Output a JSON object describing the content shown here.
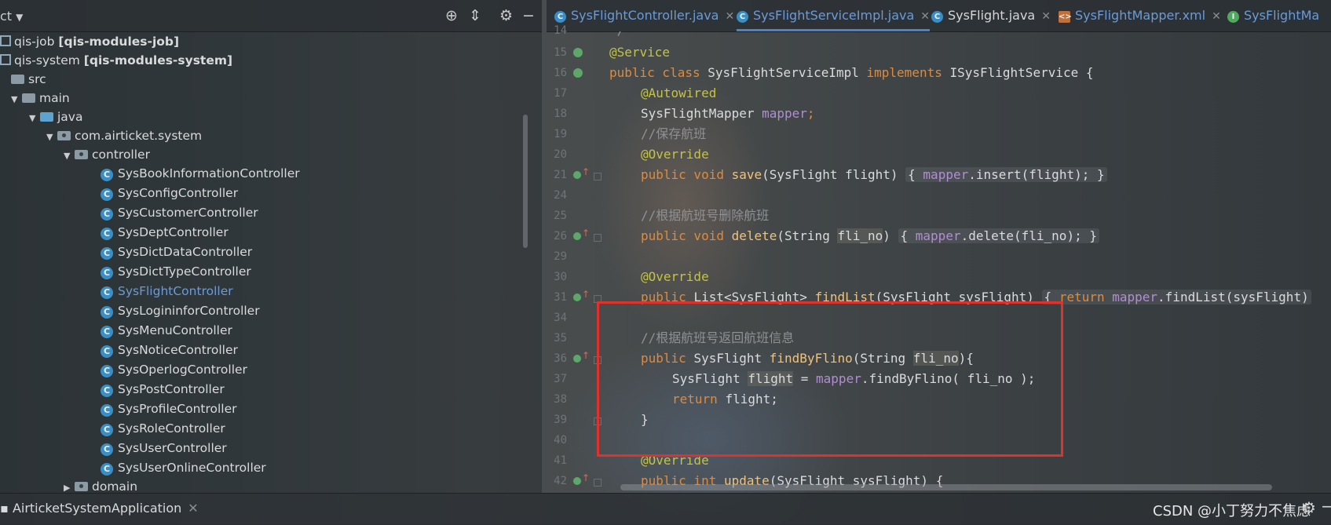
{
  "project_panel": {
    "title": "ct",
    "tree": [
      {
        "label": "qis-job",
        "bold": "[qis-modules-job]",
        "kind": "module"
      },
      {
        "label": "qis-system",
        "bold": "[qis-modules-system]",
        "kind": "module"
      },
      {
        "label": "src",
        "kind": "folder"
      },
      {
        "label": "main",
        "kind": "folder"
      },
      {
        "label": "java",
        "kind": "folder-blue"
      },
      {
        "label": "com.airticket.system",
        "kind": "package"
      },
      {
        "label": "controller",
        "kind": "package"
      },
      {
        "label": "SysBookInformationController",
        "kind": "class"
      },
      {
        "label": "SysConfigController",
        "kind": "class"
      },
      {
        "label": "SysCustomerController",
        "kind": "class"
      },
      {
        "label": "SysDeptController",
        "kind": "class"
      },
      {
        "label": "SysDictDataController",
        "kind": "class"
      },
      {
        "label": "SysDictTypeController",
        "kind": "class"
      },
      {
        "label": "SysFlightController",
        "kind": "class"
      },
      {
        "label": "SysLogininforController",
        "kind": "class"
      },
      {
        "label": "SysMenuController",
        "kind": "class"
      },
      {
        "label": "SysNoticeController",
        "kind": "class"
      },
      {
        "label": "SysOperlogController",
        "kind": "class"
      },
      {
        "label": "SysPostController",
        "kind": "class"
      },
      {
        "label": "SysProfileController",
        "kind": "class"
      },
      {
        "label": "SysRoleController",
        "kind": "class"
      },
      {
        "label": "SysUserController",
        "kind": "class"
      },
      {
        "label": "SysUserOnlineController",
        "kind": "class"
      },
      {
        "label": "domain",
        "kind": "package"
      }
    ]
  },
  "editor": {
    "tabs": [
      {
        "label": "SysFlightController.java",
        "icon": "C"
      },
      {
        "label": "SysFlightServiceImpl.java",
        "icon": "C"
      },
      {
        "label": "SysFlight.java",
        "icon": "C"
      },
      {
        "label": "SysFlightMapper.xml",
        "icon": "xml"
      },
      {
        "label": "SysFlightMa",
        "icon": "I"
      }
    ],
    "line_numbers": [
      "14",
      "15",
      "16",
      "17",
      "18",
      "19",
      "20",
      "21",
      "24",
      "25",
      "26",
      "29",
      "30",
      "31",
      "34",
      "35",
      "36",
      "37",
      "38",
      "39",
      "40",
      "41",
      "42"
    ],
    "code": {
      "l14": "*/",
      "l15": "@Service",
      "l16_kw1": "public class",
      "l16_name": " SysFlightServiceImpl ",
      "l16_kw2": "implements",
      "l16_rest": " ISysFlightService {",
      "l17": "@Autowired",
      "l18_type": "SysFlightMapper ",
      "l18_field": "mapper",
      "l18_semi": ";",
      "l19": "//保存航班",
      "l20": "@Override",
      "l21_kw": "public void ",
      "l21_name": "save",
      "l21_args": "(SysFlight flight) ",
      "l21_body1": "{ ",
      "l21_field": "mapper",
      "l21_body2": ".insert(flight); }",
      "l25": "//根据航班号删除航班",
      "l26_kw": "public void ",
      "l26_name": "delete",
      "l26_a1": "(String ",
      "l26_param": "fli_no",
      "l26_a2": ") ",
      "l26_b1": "{ ",
      "l26_field": "mapper",
      "l26_b2": ".delete(fli_no); }",
      "l30": "@Override",
      "l31_kw": "public ",
      "l31_type": "List<SysFlight> ",
      "l31_name": "findList",
      "l31_args": "(SysFlight sysFlight) ",
      "l31_b1": "{ ",
      "l31_ret": "return ",
      "l31_field": "mapper",
      "l31_b2": ".findList(sysFlight)",
      "l35": "//根据航班号返回航班信息",
      "l36_kw": "public ",
      "l36_type": "SysFlight ",
      "l36_name": "findByFlino",
      "l36_a1": "(String ",
      "l36_param": "fli_no",
      "l36_a2": "){",
      "l37_type": "SysFlight ",
      "l37_var": "flight",
      "l37_eq": " = ",
      "l37_field": "mapper",
      "l37_rest": ".findByFlino( fli_no );",
      "l38_kw": "return ",
      "l38_rest": "flight;",
      "l39": "}",
      "l41": "@Override",
      "l42_kw": "public int ",
      "l42_name": "update",
      "l42_rest": "(SysFlight sysFlight) {"
    }
  },
  "bottom_bar": {
    "run_tab": "AirticketSystemApplication",
    "watermark": "CSDN @小丁努力不焦虑"
  },
  "colors": {
    "highlight_box": "#e0322c",
    "accent": "#6a9bd6",
    "keyword": "#e08a3a",
    "annotation": "#c4c440",
    "field": "#b38dd4"
  }
}
